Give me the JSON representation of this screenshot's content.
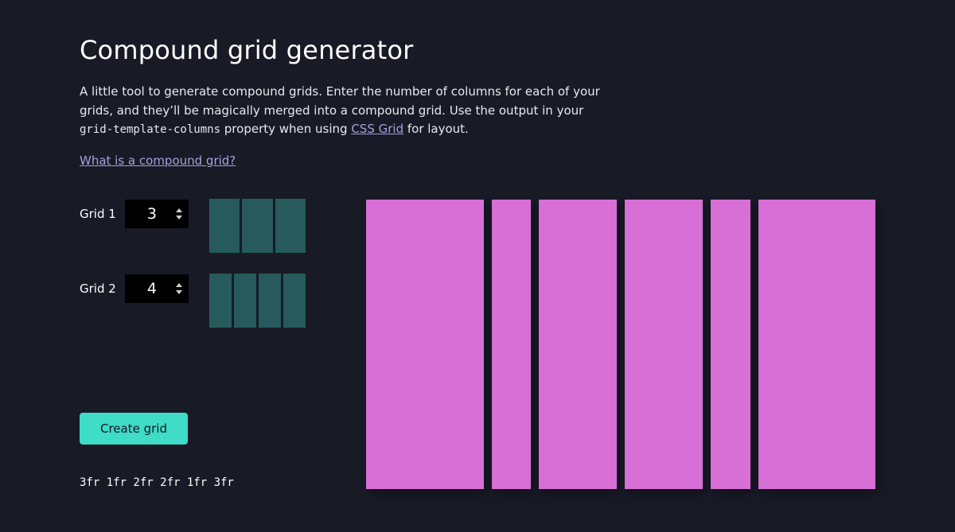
{
  "header": {
    "title": "Compound grid generator"
  },
  "intro": {
    "text_1": "A little tool to generate compound grids. Enter the number of columns for each of your grids, and they’ll be magically merged into a compound grid. Use the output in your ",
    "code": "grid-template-columns",
    "text_2": " property when using ",
    "link": "CSS Grid",
    "text_3": " for layout."
  },
  "what_link": "What is a compound grid?",
  "grids": [
    {
      "label": "Grid 1",
      "value": "3",
      "columns": 3
    },
    {
      "label": "Grid 2",
      "value": "4",
      "columns": 4
    }
  ],
  "create_button": "Create grid",
  "output": "3fr 1fr 2fr 2fr 1fr 3fr",
  "compound_columns": [
    3,
    1,
    2,
    2,
    1,
    3
  ],
  "colors": {
    "background": "#181a26",
    "preview_column": "#265a5c",
    "compound_column": "#d76fd6",
    "button": "#3fdcc8",
    "link": "#a9a0da"
  }
}
